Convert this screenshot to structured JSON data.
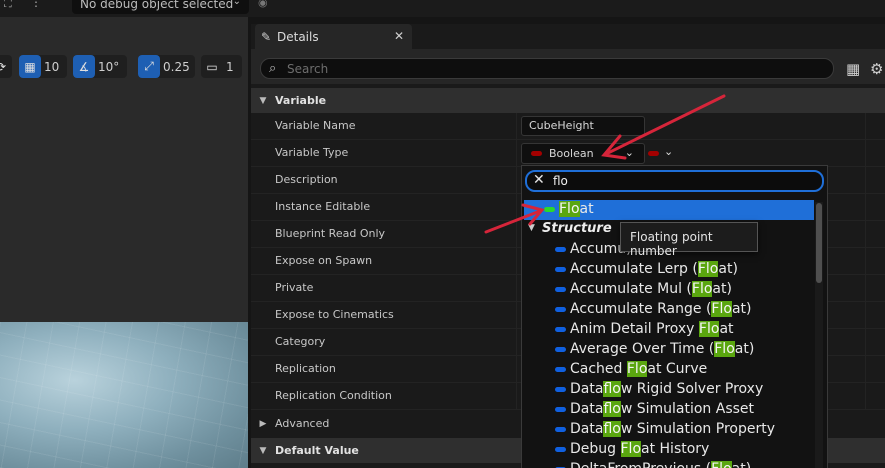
{
  "top_bar": {
    "debug_object": "No debug object selected"
  },
  "viewport": {
    "grid_value": "10",
    "rotation_value": "10°",
    "scale_value": "0.25",
    "camera_value": "1"
  },
  "details": {
    "tab_label": "Details",
    "search_placeholder": "Search",
    "sections": {
      "variable": "Variable",
      "advanced": "Advanced",
      "default_value": "Default Value"
    },
    "properties": [
      {
        "label": "Variable Name"
      },
      {
        "label": "Variable Type"
      },
      {
        "label": "Description"
      },
      {
        "label": "Instance Editable"
      },
      {
        "label": "Blueprint Read Only"
      },
      {
        "label": "Expose on Spawn"
      },
      {
        "label": "Private"
      },
      {
        "label": "Expose to Cinematics"
      },
      {
        "label": "Category"
      },
      {
        "label": "Replication"
      },
      {
        "label": "Replication Condition"
      }
    ],
    "variable_name_value": "CubeHeight",
    "variable_type_value": "Boolean"
  },
  "type_picker": {
    "query": "flo",
    "selected_item": {
      "pre": "",
      "match": "Flo",
      "post": "at",
      "pill_color": "#2bd92b"
    },
    "category": "Structure",
    "items": [
      {
        "pre": "Accumu",
        "match": "",
        "post": "",
        "tail": ")",
        "pill_color": "#1060e0"
      },
      {
        "pre": "Accumulate Lerp (",
        "match": "Flo",
        "post": "at)",
        "pill_color": "#1060e0"
      },
      {
        "pre": "Accumulate Mul (",
        "match": "Flo",
        "post": "at)",
        "pill_color": "#1060e0"
      },
      {
        "pre": "Accumulate Range (",
        "match": "Flo",
        "post": "at)",
        "pill_color": "#1060e0"
      },
      {
        "pre": "Anim Detail Proxy ",
        "match": "Flo",
        "post": "at",
        "pill_color": "#1060e0"
      },
      {
        "pre": "Average Over Time (",
        "match": "Flo",
        "post": "at)",
        "pill_color": "#1060e0"
      },
      {
        "pre": "Cached ",
        "match": "Flo",
        "post": "at Curve",
        "pill_color": "#1060e0"
      },
      {
        "pre": "Data",
        "match": "flo",
        "post": "w Rigid Solver Proxy",
        "pill_color": "#1060e0"
      },
      {
        "pre": "Data",
        "match": "flo",
        "post": "w Simulation Asset",
        "pill_color": "#1060e0"
      },
      {
        "pre": "Data",
        "match": "flo",
        "post": "w Simulation Property",
        "pill_color": "#1060e0"
      },
      {
        "pre": "Debug ",
        "match": "Flo",
        "post": "at History",
        "pill_color": "#1060e0"
      },
      {
        "pre": "DeltaFromPrevious (",
        "match": "Flo",
        "post": "at)",
        "pill_color": "#1060e0"
      }
    ],
    "tooltip": "Floating point number"
  },
  "colors": {
    "accent_blue": "#1f6fd8",
    "boolean_red": "#a30000",
    "match_highlight": "#5aa60f",
    "annotation_arrow": "#d6253a"
  }
}
